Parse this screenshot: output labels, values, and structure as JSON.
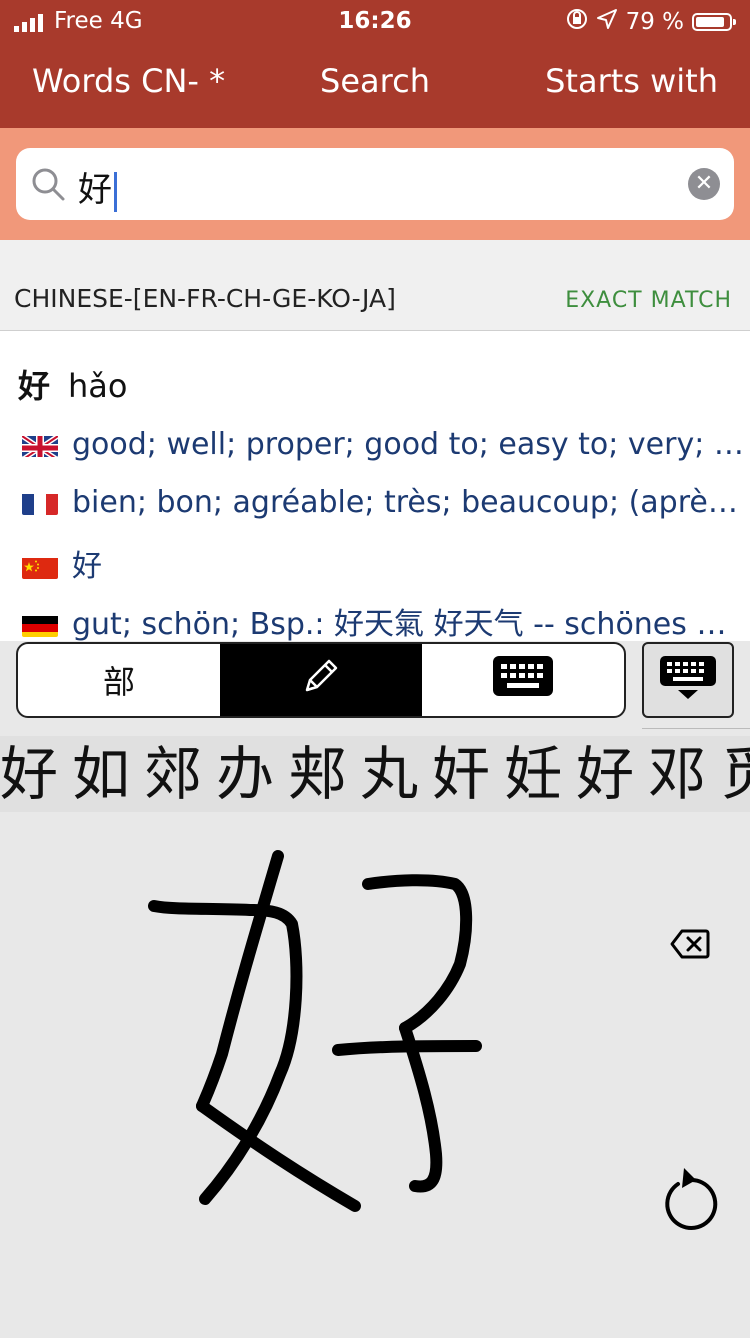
{
  "status": {
    "carrier": "Free  4G",
    "time": "16:26",
    "battery": "79 %"
  },
  "nav": {
    "left": "Words   CN- *",
    "title": "Search",
    "right": "Starts with"
  },
  "search": {
    "value": "好",
    "search_icon": "search-icon",
    "clear_icon": "clear-icon"
  },
  "results": {
    "dictionary": "CHINESE-[EN-FR-CH-GE-KO-JA]",
    "match": "EXACT MATCH"
  },
  "entry": {
    "hanzi": "好",
    "pinyin": "hǎo",
    "definitions": [
      {
        "lang": "gb-flag",
        "text": "good; well; proper; good to; easy to; very; so; (suffix indicating completion or readiness); (of two people) close; on intimate terms; (after a personal pronoun) hello"
      },
      {
        "lang": "fr-flag",
        "text": "bien; bon; agréable; très; beaucoup; (après un verbe, indique l'achèvement)"
      },
      {
        "lang": "cn-flag",
        "text": "好"
      },
      {
        "lang": "de-flag",
        "text": "gut; schön; Bsp.: 好天氣 好天气 -- schönes Wetter"
      }
    ]
  },
  "tabs": {
    "radical": "部",
    "handwriting_icon": "pencil-icon",
    "keyboard_icon": "keyboard-icon",
    "hide_keyboard_icon": "keyboard-hide-icon"
  },
  "candidates": [
    "好",
    "如",
    "郊",
    "办",
    "郏",
    "丸",
    "奸",
    "妊",
    "好",
    "邓",
    "觅"
  ],
  "canvas": {
    "backspace_icon": "backspace-icon",
    "refresh_icon": "refresh-icon"
  },
  "colors": {
    "header": "#a83a2c",
    "search_band": "#f1987a",
    "definition": "#1c3a72",
    "match": "#3e8e3e"
  }
}
